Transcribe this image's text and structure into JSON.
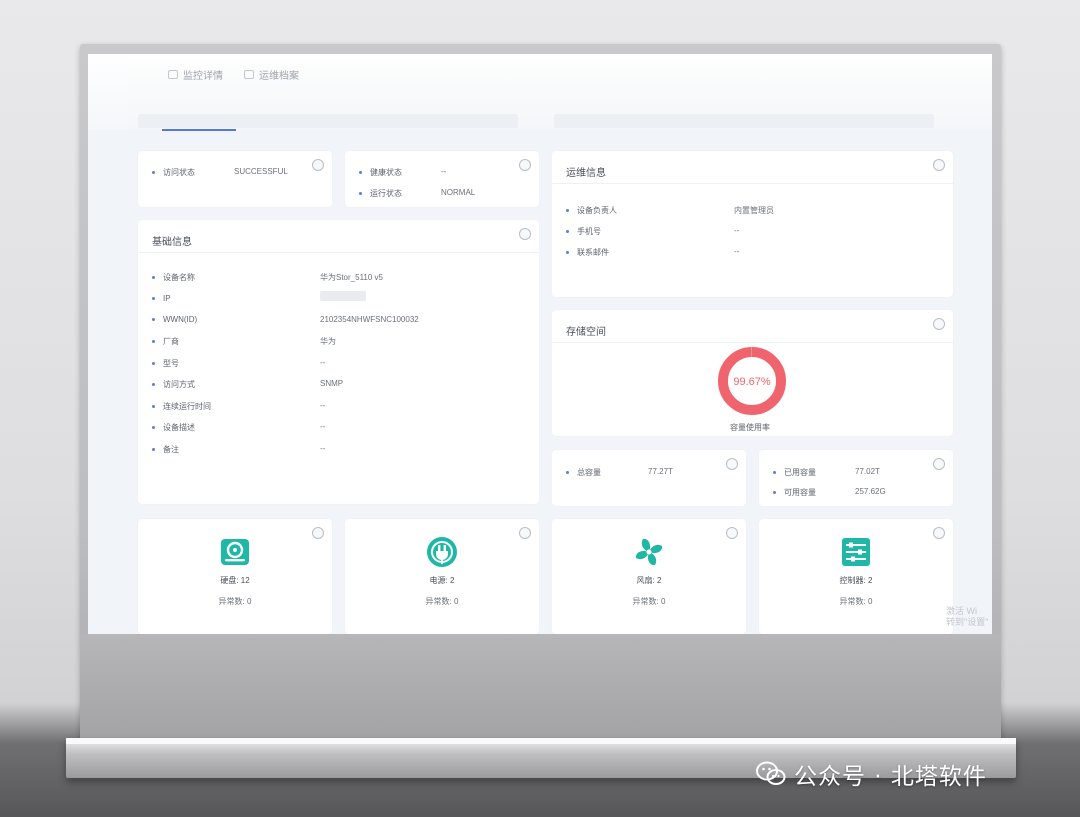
{
  "tabs": [
    {
      "label": "监控详情"
    },
    {
      "label": "运维档案"
    }
  ],
  "access_card": {
    "rows": [
      {
        "key": "访问状态",
        "value": "SUCCESSFUL"
      }
    ]
  },
  "health_card": {
    "rows": [
      {
        "key": "健康状态",
        "value": "--"
      },
      {
        "key": "运行状态",
        "value": "NORMAL"
      }
    ]
  },
  "basic_info": {
    "title": "基础信息",
    "rows": [
      {
        "key": "设备名称",
        "value": "华为Stor_5110 v5"
      },
      {
        "key": "IP",
        "value": ""
      },
      {
        "key": "WWN(ID)",
        "value": "2102354NHWFSNC100032"
      },
      {
        "key": "厂商",
        "value": "华为"
      },
      {
        "key": "型号",
        "value": "--"
      },
      {
        "key": "访问方式",
        "value": "SNMP"
      },
      {
        "key": "连续运行时间",
        "value": "--"
      },
      {
        "key": "设备描述",
        "value": "--"
      },
      {
        "key": "备注",
        "value": "--"
      }
    ]
  },
  "ops_info": {
    "title": "运维信息",
    "rows": [
      {
        "key": "设备负责人",
        "value": "内置管理员"
      },
      {
        "key": "手机号",
        "value": "--"
      },
      {
        "key": "联系邮件",
        "value": "--"
      }
    ]
  },
  "storage": {
    "title": "存储空间",
    "usage_percent": 99.67,
    "usage_text": "99.67%",
    "ring_label": "容量使用率",
    "ring_color": "#f0656d"
  },
  "capacity_total": {
    "key": "总容量",
    "value": "77.27T"
  },
  "capacity_detail": {
    "rows": [
      {
        "key": "已用容量",
        "value": "77.02T"
      },
      {
        "key": "可用容量",
        "value": "257.62G"
      }
    ]
  },
  "components": [
    {
      "icon": "disk-icon",
      "label": "硬盘: 12",
      "sub": "异常数: 0"
    },
    {
      "icon": "power-icon",
      "label": "电源: 2",
      "sub": "异常数: 0"
    },
    {
      "icon": "fan-icon",
      "label": "风扇: 2",
      "sub": "异常数: 0"
    },
    {
      "icon": "controller-icon",
      "label": "控制器: 2",
      "sub": "异常数: 0"
    }
  ],
  "accent_color": "#1fb8a6",
  "os_watermark": {
    "line1": "激活 Wi",
    "line2": "转到\"设置\""
  },
  "footer_watermark": "公众号 · 北塔软件"
}
